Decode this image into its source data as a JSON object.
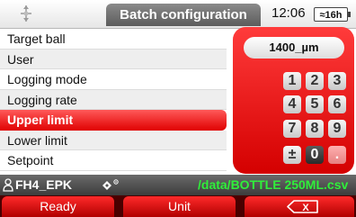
{
  "header": {
    "app_icon": "probe-icon",
    "title": "Batch configuration",
    "time": "12:06",
    "battery": "≈16h"
  },
  "menu": {
    "items": [
      {
        "label": "Target ball",
        "selected": false
      },
      {
        "label": "User",
        "selected": false
      },
      {
        "label": "Logging mode",
        "selected": false
      },
      {
        "label": "Logging rate",
        "selected": false
      },
      {
        "label": "Upper limit",
        "selected": true
      },
      {
        "label": "Lower limit",
        "selected": false
      },
      {
        "label": "Setpoint",
        "selected": false
      }
    ]
  },
  "keypad": {
    "value": "1400_µm",
    "keys": [
      "1",
      "2",
      "3",
      "4",
      "5",
      "6",
      "7",
      "8",
      "9",
      "±",
      "0",
      "."
    ]
  },
  "status": {
    "user": "FH4_EPK",
    "usb_icon": "usb-device-icon",
    "path": "/data/BOTTLE 250ML.csv"
  },
  "softkeys": {
    "left": "Ready",
    "middle": "Unit",
    "right_icon": "backspace-icon",
    "right": "X"
  },
  "colors": {
    "accent_red": "#e00000",
    "path_green": "#2ff03a",
    "status_gray": "#4f4f4f"
  }
}
